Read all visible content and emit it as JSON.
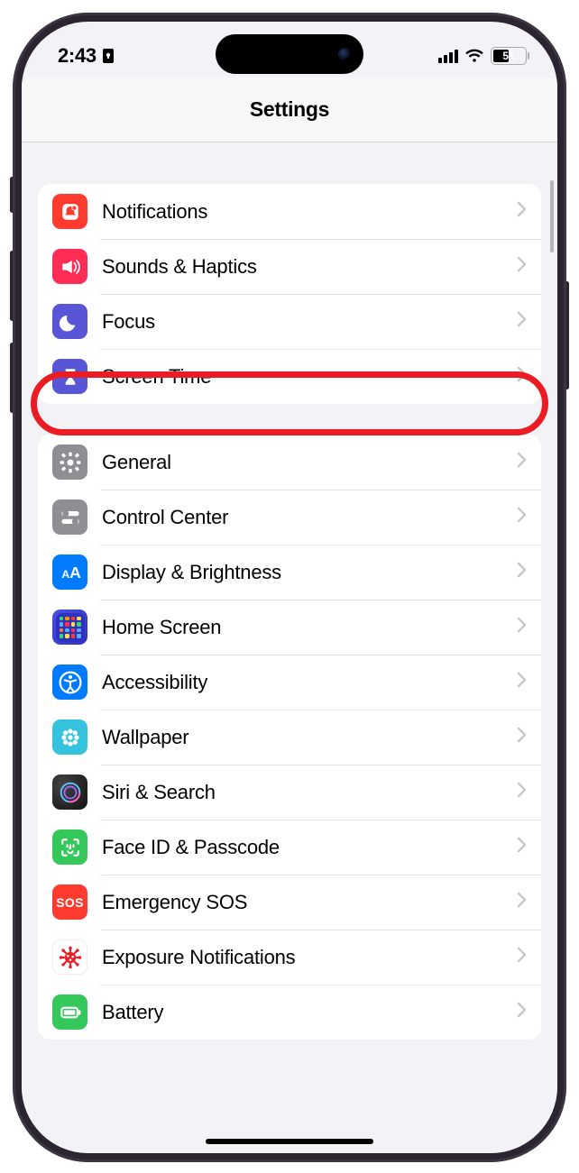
{
  "status": {
    "time": "2:43",
    "battery_pct": 51
  },
  "header": {
    "title": "Settings"
  },
  "groups": [
    {
      "id": "attention",
      "items": [
        {
          "id": "notifications",
          "label": "Notifications",
          "icon": "bell-badge-icon",
          "color": "bg-red"
        },
        {
          "id": "sounds",
          "label": "Sounds & Haptics",
          "icon": "speaker-icon",
          "color": "bg-pink"
        },
        {
          "id": "focus",
          "label": "Focus",
          "icon": "moon-icon",
          "color": "bg-indigo",
          "highlight": true
        },
        {
          "id": "screentime",
          "label": "Screen Time",
          "icon": "hourglass-icon",
          "color": "bg-indigo"
        }
      ]
    },
    {
      "id": "device",
      "items": [
        {
          "id": "general",
          "label": "General",
          "icon": "gear-icon",
          "color": "bg-gray"
        },
        {
          "id": "controlcenter",
          "label": "Control Center",
          "icon": "switches-icon",
          "color": "bg-gray"
        },
        {
          "id": "display",
          "label": "Display & Brightness",
          "icon": "textsize-icon",
          "color": "bg-blue"
        },
        {
          "id": "homescreen",
          "label": "Home Screen",
          "icon": "grid-icon",
          "color": "bg-home"
        },
        {
          "id": "accessibility",
          "label": "Accessibility",
          "icon": "accessibility-icon",
          "color": "bg-blue"
        },
        {
          "id": "wallpaper",
          "label": "Wallpaper",
          "icon": "flower-icon",
          "color": "bg-cyan"
        },
        {
          "id": "siri",
          "label": "Siri & Search",
          "icon": "siri-icon",
          "color": "bg-dark"
        },
        {
          "id": "faceid",
          "label": "Face ID & Passcode",
          "icon": "faceid-icon",
          "color": "bg-green"
        },
        {
          "id": "sos",
          "label": "Emergency SOS",
          "icon": "sos-icon",
          "color": "bg-sos"
        },
        {
          "id": "exposure",
          "label": "Exposure Notifications",
          "icon": "covid-icon",
          "color": "bg-white"
        },
        {
          "id": "battery",
          "label": "Battery",
          "icon": "battery-icon",
          "color": "bg-lime"
        }
      ]
    }
  ]
}
